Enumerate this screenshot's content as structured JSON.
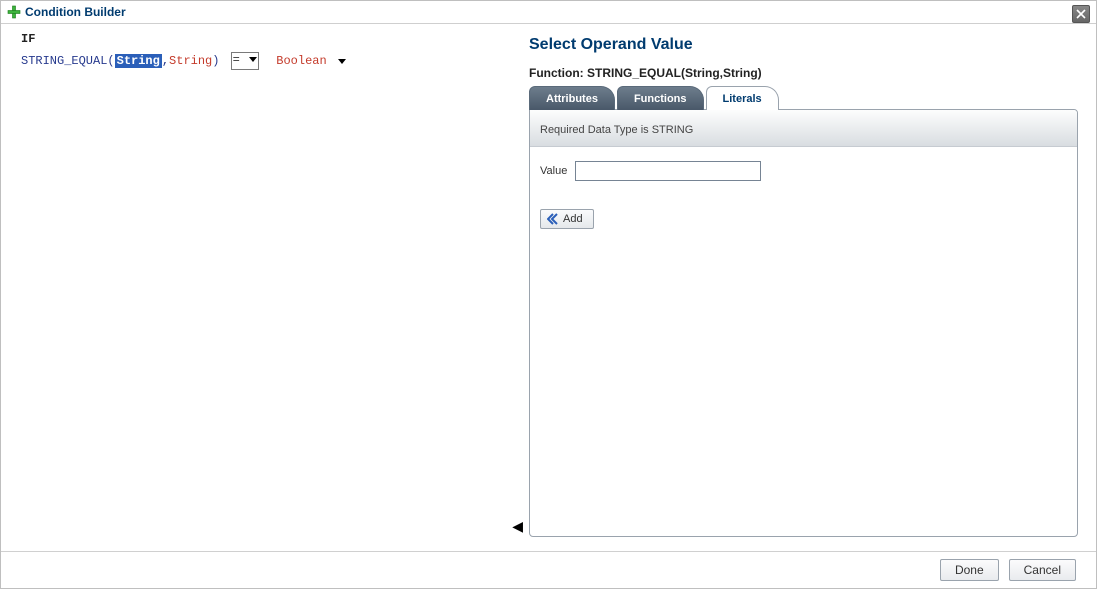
{
  "dialog": {
    "title": "Condition Builder"
  },
  "left": {
    "if_label": "IF",
    "function_name": "STRING_EQUAL",
    "open_paren": "(",
    "arg_selected": "String",
    "arg_sep": ",",
    "arg_other": "String",
    "close_paren": ")",
    "operator": "=",
    "result_type": "Boolean"
  },
  "right": {
    "title": "Select Operand Value",
    "function_sig": "Function: STRING_EQUAL(String,String)",
    "tabs": {
      "attributes": "Attributes",
      "functions": "Functions",
      "literals": "Literals"
    },
    "required_text": "Required Data Type is STRING",
    "value_label": "Value",
    "value_input": "",
    "add_label": "Add"
  },
  "footer": {
    "done": "Done",
    "cancel": "Cancel"
  }
}
